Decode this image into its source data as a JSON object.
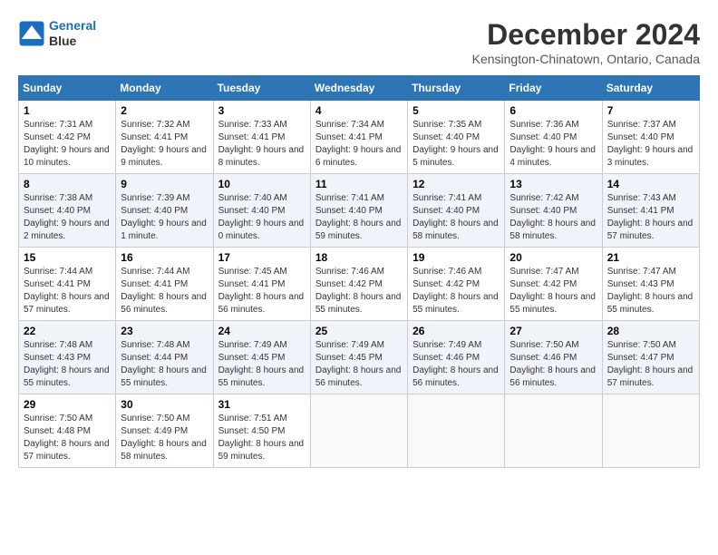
{
  "header": {
    "logo_line1": "General",
    "logo_line2": "Blue",
    "month": "December 2024",
    "location": "Kensington-Chinatown, Ontario, Canada"
  },
  "weekdays": [
    "Sunday",
    "Monday",
    "Tuesday",
    "Wednesday",
    "Thursday",
    "Friday",
    "Saturday"
  ],
  "weeks": [
    [
      {
        "day": "1",
        "sunrise": "7:31 AM",
        "sunset": "4:42 PM",
        "daylight": "9 hours and 10 minutes."
      },
      {
        "day": "2",
        "sunrise": "7:32 AM",
        "sunset": "4:41 PM",
        "daylight": "9 hours and 9 minutes."
      },
      {
        "day": "3",
        "sunrise": "7:33 AM",
        "sunset": "4:41 PM",
        "daylight": "9 hours and 8 minutes."
      },
      {
        "day": "4",
        "sunrise": "7:34 AM",
        "sunset": "4:41 PM",
        "daylight": "9 hours and 6 minutes."
      },
      {
        "day": "5",
        "sunrise": "7:35 AM",
        "sunset": "4:40 PM",
        "daylight": "9 hours and 5 minutes."
      },
      {
        "day": "6",
        "sunrise": "7:36 AM",
        "sunset": "4:40 PM",
        "daylight": "9 hours and 4 minutes."
      },
      {
        "day": "7",
        "sunrise": "7:37 AM",
        "sunset": "4:40 PM",
        "daylight": "9 hours and 3 minutes."
      }
    ],
    [
      {
        "day": "8",
        "sunrise": "7:38 AM",
        "sunset": "4:40 PM",
        "daylight": "9 hours and 2 minutes."
      },
      {
        "day": "9",
        "sunrise": "7:39 AM",
        "sunset": "4:40 PM",
        "daylight": "9 hours and 1 minute."
      },
      {
        "day": "10",
        "sunrise": "7:40 AM",
        "sunset": "4:40 PM",
        "daylight": "9 hours and 0 minutes."
      },
      {
        "day": "11",
        "sunrise": "7:41 AM",
        "sunset": "4:40 PM",
        "daylight": "8 hours and 59 minutes."
      },
      {
        "day": "12",
        "sunrise": "7:41 AM",
        "sunset": "4:40 PM",
        "daylight": "8 hours and 58 minutes."
      },
      {
        "day": "13",
        "sunrise": "7:42 AM",
        "sunset": "4:40 PM",
        "daylight": "8 hours and 58 minutes."
      },
      {
        "day": "14",
        "sunrise": "7:43 AM",
        "sunset": "4:41 PM",
        "daylight": "8 hours and 57 minutes."
      }
    ],
    [
      {
        "day": "15",
        "sunrise": "7:44 AM",
        "sunset": "4:41 PM",
        "daylight": "8 hours and 57 minutes."
      },
      {
        "day": "16",
        "sunrise": "7:44 AM",
        "sunset": "4:41 PM",
        "daylight": "8 hours and 56 minutes."
      },
      {
        "day": "17",
        "sunrise": "7:45 AM",
        "sunset": "4:41 PM",
        "daylight": "8 hours and 56 minutes."
      },
      {
        "day": "18",
        "sunrise": "7:46 AM",
        "sunset": "4:42 PM",
        "daylight": "8 hours and 55 minutes."
      },
      {
        "day": "19",
        "sunrise": "7:46 AM",
        "sunset": "4:42 PM",
        "daylight": "8 hours and 55 minutes."
      },
      {
        "day": "20",
        "sunrise": "7:47 AM",
        "sunset": "4:42 PM",
        "daylight": "8 hours and 55 minutes."
      },
      {
        "day": "21",
        "sunrise": "7:47 AM",
        "sunset": "4:43 PM",
        "daylight": "8 hours and 55 minutes."
      }
    ],
    [
      {
        "day": "22",
        "sunrise": "7:48 AM",
        "sunset": "4:43 PM",
        "daylight": "8 hours and 55 minutes."
      },
      {
        "day": "23",
        "sunrise": "7:48 AM",
        "sunset": "4:44 PM",
        "daylight": "8 hours and 55 minutes."
      },
      {
        "day": "24",
        "sunrise": "7:49 AM",
        "sunset": "4:45 PM",
        "daylight": "8 hours and 55 minutes."
      },
      {
        "day": "25",
        "sunrise": "7:49 AM",
        "sunset": "4:45 PM",
        "daylight": "8 hours and 56 minutes."
      },
      {
        "day": "26",
        "sunrise": "7:49 AM",
        "sunset": "4:46 PM",
        "daylight": "8 hours and 56 minutes."
      },
      {
        "day": "27",
        "sunrise": "7:50 AM",
        "sunset": "4:46 PM",
        "daylight": "8 hours and 56 minutes."
      },
      {
        "day": "28",
        "sunrise": "7:50 AM",
        "sunset": "4:47 PM",
        "daylight": "8 hours and 57 minutes."
      }
    ],
    [
      {
        "day": "29",
        "sunrise": "7:50 AM",
        "sunset": "4:48 PM",
        "daylight": "8 hours and 57 minutes."
      },
      {
        "day": "30",
        "sunrise": "7:50 AM",
        "sunset": "4:49 PM",
        "daylight": "8 hours and 58 minutes."
      },
      {
        "day": "31",
        "sunrise": "7:51 AM",
        "sunset": "4:50 PM",
        "daylight": "8 hours and 59 minutes."
      },
      null,
      null,
      null,
      null
    ]
  ]
}
